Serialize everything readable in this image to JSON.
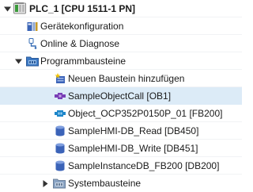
{
  "tree": {
    "device": {
      "label": "PLC_1 [CPU 1511-1 PN]",
      "expanded": true,
      "icon": "plc-device-icon"
    },
    "items": [
      {
        "label": "Gerätekonfiguration",
        "icon": "device-configuration-icon"
      },
      {
        "label": "Online & Diagnose",
        "icon": "online-diagnostics-icon"
      }
    ],
    "program_blocks": {
      "label": "Programmbausteine",
      "expanded": true,
      "icon": "program-blocks-folder-icon",
      "children": [
        {
          "label": "Neuen Baustein hinzufügen",
          "icon": "add-new-block-icon"
        },
        {
          "label": "SampleObjectCall [OB1]",
          "icon": "organization-block-icon",
          "selected": true
        },
        {
          "label": "Object_OCP352P0150P_01 [FB200]",
          "icon": "function-block-icon"
        },
        {
          "label": "SampleHMI-DB_Read [DB450]",
          "icon": "data-block-icon"
        },
        {
          "label": "SampleHMI-DB_Write [DB451]",
          "icon": "data-block-icon"
        },
        {
          "label": "SampleInstanceDB_FB200 [DB200]",
          "icon": "data-block-icon"
        }
      ]
    },
    "system_blocks": {
      "label": "Systembausteine",
      "expanded": false,
      "icon": "system-blocks-folder-icon"
    }
  },
  "colors": {
    "selection_background": "#dcebf7",
    "data_block": "#3b63b8",
    "function_block": "#1d86c9",
    "organization_block": "#7a3fb6",
    "folder": "#3c79c4"
  }
}
